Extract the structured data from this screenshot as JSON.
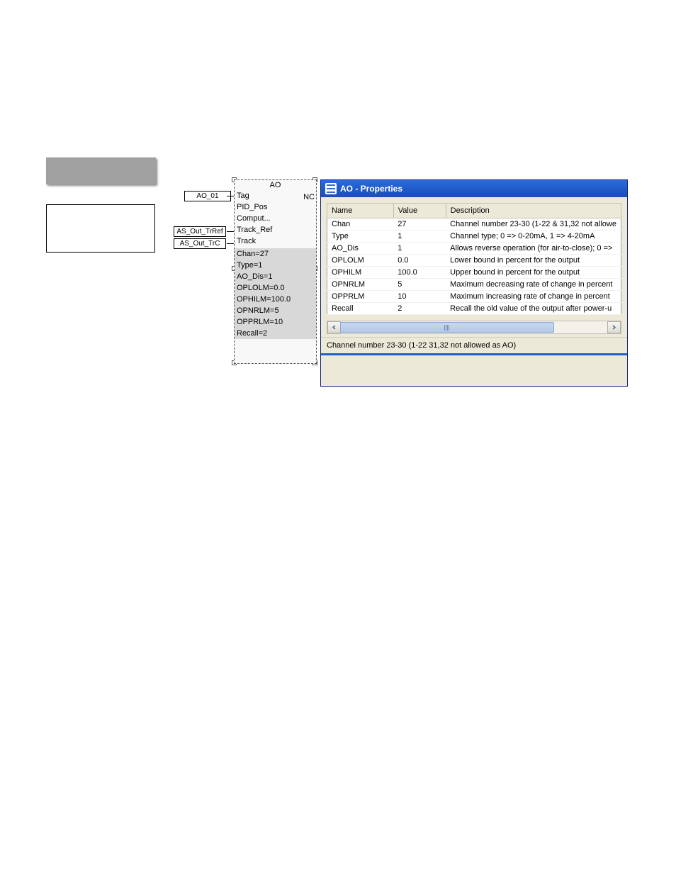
{
  "graybox": {},
  "whitebox": {},
  "block": {
    "title": "AO",
    "nc": "NC",
    "inputs": [
      {
        "pin": "AO_01",
        "port": "Tag"
      },
      {
        "pin": "",
        "port": "PID_Pos"
      },
      {
        "pin": "",
        "port": "Comput..."
      },
      {
        "pin": "AS_Out_TrRef",
        "port": "Track_Ref"
      },
      {
        "pin": "AS_Out_TrC",
        "port": "Track"
      }
    ],
    "params": [
      "Chan=27",
      "Type=1",
      "AO_Dis=1",
      "OPLOLM=0.0",
      "OPHILM=100.0",
      "OPNRLM=5",
      "OPPRLM=10",
      "Recall=2"
    ]
  },
  "props": {
    "title": "AO - Properties",
    "headers": {
      "name": "Name",
      "value": "Value",
      "desc": "Description"
    },
    "rows": [
      {
        "name": "Chan",
        "value": "27",
        "desc": "Channel number 23-30 (1-22 & 31,32 not allowe"
      },
      {
        "name": "Type",
        "value": "1",
        "desc": "Channel type; 0 => 0-20mA, 1 => 4-20mA"
      },
      {
        "name": "AO_Dis",
        "value": "1",
        "desc": "Allows reverse operation (for air-to-close); 0 =>"
      },
      {
        "name": "OPLOLM",
        "value": "0.0",
        "desc": "Lower bound in percent for the output"
      },
      {
        "name": "OPHILM",
        "value": "100.0",
        "desc": "Upper bound in percent for the output"
      },
      {
        "name": "OPNRLM",
        "value": "5",
        "desc": "Maximum decreasing rate of change in percent"
      },
      {
        "name": "OPPRLM",
        "value": "10",
        "desc": "Maximum increasing rate of change in percent"
      },
      {
        "name": "Recall",
        "value": "2",
        "desc": "Recall the old value of the output after power-u"
      }
    ],
    "status": "Channel number 23-30 (1-22 31,32 not allowed as AO)"
  }
}
